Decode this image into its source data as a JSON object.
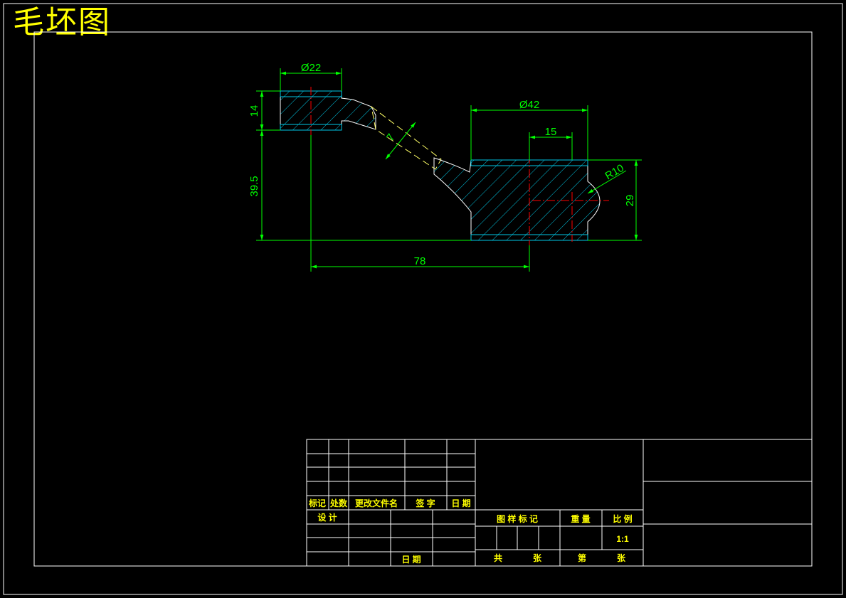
{
  "drawing_title": "毛坯图",
  "colors": {
    "background": "#000000",
    "frame": "#ffffff",
    "dimension": "#00ff00",
    "hatch": "#00c8e6",
    "centerline": "#ff0000",
    "outline": "#ffffff",
    "title_text": "#ffff00"
  },
  "dimensions": {
    "small_boss_diameter": "Ø22",
    "small_boss_height": "14",
    "arm_thickness": "7",
    "large_boss_diameter": "Ø42",
    "large_offset": "15",
    "notch_radius": "R10",
    "large_boss_height": "29",
    "height_offset": "39.5",
    "center_distance": "78"
  },
  "title_block": {
    "rev_header": {
      "mark": "标记",
      "count": "处数",
      "doc": "更改文件名",
      "sign": "签 字",
      "date": "日 期"
    },
    "design_label": "设 计",
    "date_label": "日 期",
    "drawing_mark_label": "图 样 标 记",
    "weight_label": "重 量",
    "scale_label": "比 例",
    "scale_value": "1:1",
    "total_label": "共",
    "sheets_label": "张",
    "sheet_no_label": "第",
    "sheet_label": "张"
  }
}
